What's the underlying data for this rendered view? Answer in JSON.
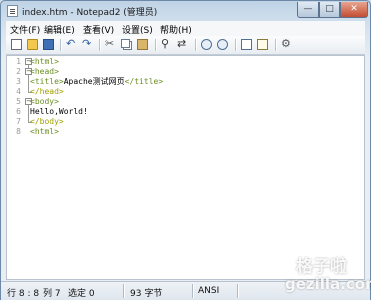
{
  "window": {
    "title": "index.htm - Notepad2 (管理员)",
    "minimize_glyph": "—",
    "maximize_glyph": "□",
    "close_glyph": "✕"
  },
  "menu": {
    "items": [
      "文件(F)",
      "编辑(E)",
      "查看(V)",
      "设置(S)",
      "帮助(H)"
    ]
  },
  "toolbar": {
    "icons": [
      "new-file-icon",
      "open-folder-icon",
      "save-icon",
      "undo-icon",
      "redo-icon",
      "cut-icon",
      "copy-icon",
      "paste-icon",
      "find-icon",
      "replace-icon",
      "zoom-in-icon",
      "zoom-out-icon",
      "view-icon",
      "word-wrap-icon",
      "settings-icon"
    ]
  },
  "editor": {
    "line_numbers": [
      "1",
      "2",
      "3",
      "4",
      "5",
      "6",
      "7",
      "8"
    ],
    "lines": [
      {
        "pre": "",
        "tag": "<html>",
        "text": "",
        "close": ""
      },
      {
        "pre": "",
        "tag": "<head>",
        "text": "",
        "close": ""
      },
      {
        "pre": "",
        "tag": "<title>",
        "text": "Apache测试网页",
        "close": "</title>"
      },
      {
        "pre": "",
        "tag": "</head>",
        "text": "",
        "close": ""
      },
      {
        "pre": "",
        "tag": "<body>",
        "text": "",
        "close": ""
      },
      {
        "pre": "",
        "tag": "",
        "text": "Hello,World!",
        "close": ""
      },
      {
        "pre": "",
        "tag": "</body>",
        "text": "",
        "close": ""
      },
      {
        "pre": "",
        "tag": "<html>",
        "text": "",
        "close": ""
      }
    ]
  },
  "status": {
    "position": "行 8 : 8",
    "column": "列 7",
    "selection": "选定 0",
    "size": "93 字节",
    "encoding": "ANSI"
  },
  "watermark": {
    "brand": "格子啦",
    "site": "gezilla.com"
  }
}
